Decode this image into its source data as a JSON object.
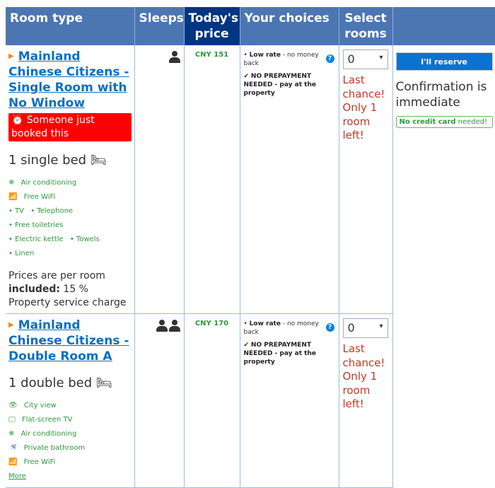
{
  "header": {
    "room_type": "Room type",
    "sleeps": "Sleeps",
    "price": "Today's price",
    "choices": "Your choices",
    "select": "Select rooms"
  },
  "rooms": [
    {
      "name": "Mainland Chinese Citizens - Single Room with No Window",
      "badge": "Someone just booked this",
      "bed": "1 single bed",
      "occupancy": 1,
      "facilities": [
        "Air conditioning",
        "Free WiFi",
        "• TV",
        "• Telephone",
        "• Free toiletries",
        "• Electric kettle",
        "• Towels",
        "• Linen"
      ],
      "note_line1": "Prices are per room",
      "note_bold": "included:",
      "note_rest": " 15 % Property service charge",
      "price": "CNY 151",
      "rate_bold": "Low rate",
      "rate_rest": " - no money back",
      "prepay": "NO PREPAYMENT NEEDED - pay at the property",
      "qty": "0",
      "last_chance": "Last chance! Only 1 room left!"
    },
    {
      "name": "Mainland Chinese Citizens - Double Room A",
      "bed": "1 double bed",
      "occupancy": 2,
      "facilities": [
        "City view",
        "Flat-screen TV",
        "Air conditioning",
        "Private bathroom",
        "Free WiFi"
      ],
      "more": "More",
      "price": "CNY 170",
      "rate_bold": "Low rate",
      "rate_rest": " - no money back",
      "prepay": "NO PREPAYMENT NEEDED - pay at the property",
      "qty": "0",
      "last_chance": "Last chance! Only 1 room left!"
    }
  ],
  "reserve": {
    "button": "I'll reserve",
    "confirmation": "Confirmation is immediate",
    "nocc_bold": "No credit card",
    "nocc_rest": " needed!"
  },
  "colors": {
    "header": "#4c76b2",
    "price_header": "#003580",
    "link": "#0b6fc1",
    "green": "#2b9a3a",
    "red": "#c0392b"
  }
}
